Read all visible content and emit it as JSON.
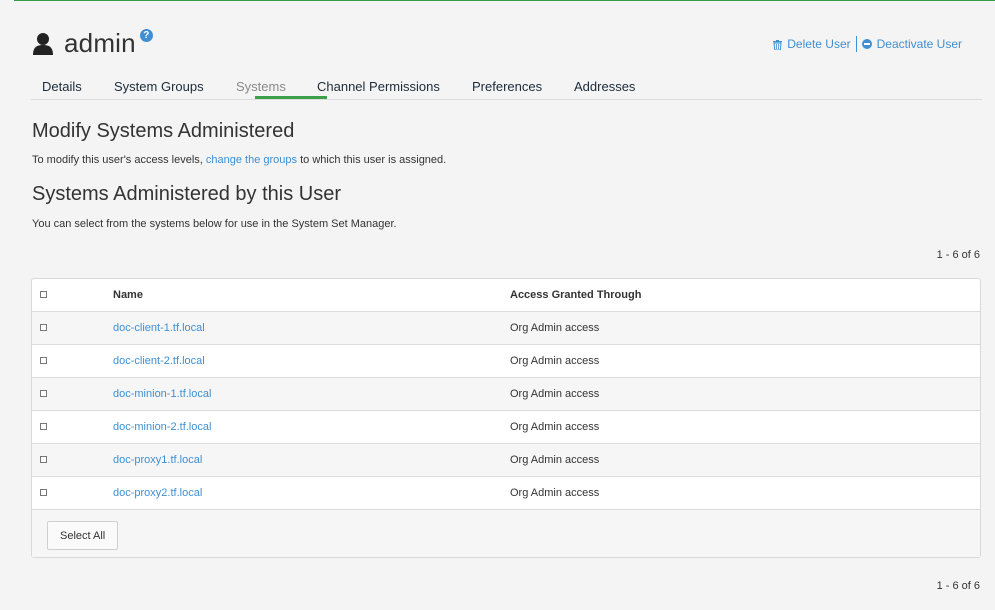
{
  "header": {
    "title": "admin",
    "help": "?",
    "actions": {
      "delete": "Delete User",
      "deactivate": "Deactivate User"
    }
  },
  "tabs": [
    "Details",
    "System Groups",
    "Systems",
    "Channel Permissions",
    "Preferences",
    "Addresses"
  ],
  "active_tab": "Systems",
  "modify": {
    "heading": "Modify Systems Administered",
    "text_before": "To modify this user's access levels,",
    "link": "change the groups",
    "text_after": "to which this user is assigned."
  },
  "administered": {
    "heading": "Systems Administered by this User",
    "text": "You can select from the systems below for use in the System Set Manager."
  },
  "pagination": "1 - 6 of 6",
  "table": {
    "columns": [
      "Name",
      "Access Granted Through"
    ],
    "rows": [
      {
        "name": "doc-client-1.tf.local",
        "access": "Org Admin access"
      },
      {
        "name": "doc-client-2.tf.local",
        "access": "Org Admin access"
      },
      {
        "name": "doc-minion-1.tf.local",
        "access": "Org Admin access"
      },
      {
        "name": "doc-minion-2.tf.local",
        "access": "Org Admin access"
      },
      {
        "name": "doc-proxy1.tf.local",
        "access": "Org Admin access"
      },
      {
        "name": "doc-proxy2.tf.local",
        "access": "Org Admin access"
      }
    ],
    "select_all": "Select All"
  },
  "colors": {
    "link": "#3f8fd2",
    "accent": "#3aa04a",
    "text": "#333333"
  }
}
